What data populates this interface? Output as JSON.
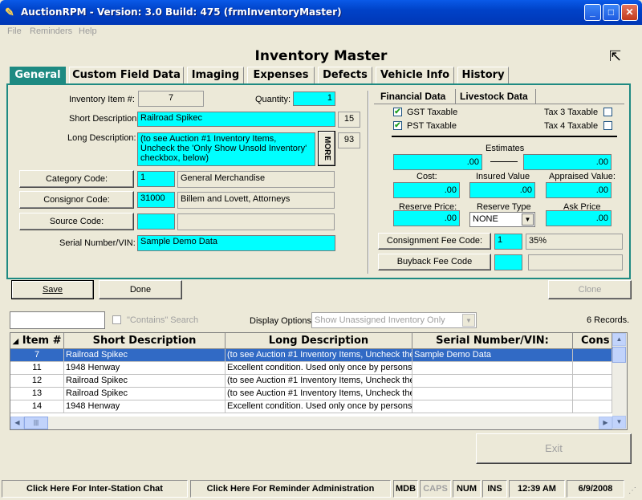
{
  "window": {
    "title": "AuctionRPM - Version: 3.0 Build: 475    (frmInventoryMaster)"
  },
  "menu": [
    "File",
    "Reminders",
    "Help"
  ],
  "page_title": "Inventory Master",
  "tabs": [
    "General",
    "Custom Field Data",
    "Imaging",
    "Expenses",
    "Defects",
    "Vehicle Info",
    "History"
  ],
  "general": {
    "item_label": "Inventory Item #:",
    "item_value": "7",
    "quantity_label": "Quantity:",
    "quantity_value": "1",
    "short_desc_label": "Short Description",
    "short_desc_value": "Railroad Spikec",
    "short_desc_len": "15",
    "long_desc_label": "Long Description:",
    "long_desc_value": "(to see Auction #1 Inventory Items, Uncheck the 'Only Show Unsold Inventory' checkbox, below)",
    "long_desc_len": "93",
    "more_label": "MORE",
    "category_btn": "Category Code:",
    "category_code": "1",
    "category_name": "General Merchandise",
    "consignor_btn": "Consignor Code:",
    "consignor_code": "31000",
    "consignor_name": "Billem and Lovett, Attorneys",
    "source_btn": "Source Code:",
    "source_code": "",
    "source_name": "",
    "serial_label": "Serial Number/VIN:",
    "serial_value": "Sample Demo Data"
  },
  "financial": {
    "tab_financial": "Financial Data",
    "tab_livestock": "Livestock Data",
    "gst_label": "GST Taxable",
    "gst_checked": true,
    "pst_label": "PST Taxable",
    "pst_checked": true,
    "tax3_label": "Tax 3 Taxable",
    "tax4_label": "Tax 4 Taxable",
    "estimates_label": "Estimates",
    "estimate_low": ".00",
    "estimate_high": ".00",
    "cost_label": "Cost:",
    "cost_value": ".00",
    "insured_label": "Insured Value",
    "insured_value": ".00",
    "appraised_label": "Appraised Value:",
    "appraised_value": ".00",
    "reserve_price_label": "Reserve Price:",
    "reserve_price_value": ".00",
    "reserve_type_label": "Reserve Type",
    "reserve_type_value": "NONE",
    "ask_price_label": "Ask Price",
    "ask_price_value": ".00",
    "consignment_fee_btn": "Consignment Fee Code:",
    "consignment_fee_code": "1",
    "consignment_fee_pct": "35%",
    "buyback_fee_btn": "Buyback Fee Code",
    "buyback_fee_code": "",
    "buyback_fee_value": ""
  },
  "actions": {
    "save": "Save",
    "done": "Done",
    "clone": "Clone",
    "exit": "Exit"
  },
  "search": {
    "value": "",
    "contains_label": "\"Contains\" Search",
    "display_label": "Display Options:",
    "display_value": "Show Unassigned Inventory Only",
    "records": "6 Records."
  },
  "grid": {
    "headers": [
      "Item #",
      "Short Description",
      "Long Description",
      "Serial Number/VIN:",
      "Cons"
    ],
    "rows": [
      [
        "7",
        "Railroad Spikec",
        "(to see Auction #1 Inventory Items, Uncheck the",
        "Sample Demo Data",
        ""
      ],
      [
        "11",
        "1948 Henway",
        "Excellent condition.  Used only once by persons",
        "",
        ""
      ],
      [
        "12",
        "Railroad Spikec",
        "(to see Auction #1 Inventory Items, Uncheck the",
        "",
        ""
      ],
      [
        "13",
        "Railroad Spikec",
        "(to see Auction #1 Inventory Items, Uncheck the",
        "",
        ""
      ],
      [
        "14",
        "1948 Henway",
        "Excellent condition.  Used only once by persons",
        "",
        ""
      ]
    ]
  },
  "status": {
    "chat": "Click Here For Inter-Station Chat",
    "reminder": "Click Here For Reminder Administration",
    "mdb": "MDB",
    "caps": "CAPS",
    "num": "NUM",
    "ins": "INS",
    "time": "12:39 AM",
    "date": "6/9/2008"
  }
}
